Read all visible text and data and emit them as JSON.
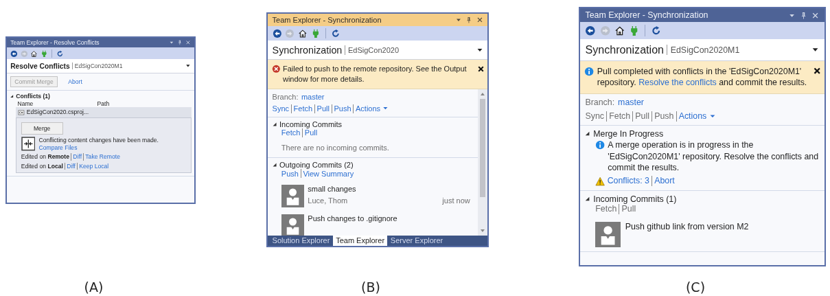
{
  "figure": [
    {
      "caption": "(A)",
      "window": {
        "title": "Team Explorer - Resolve Conflicts",
        "active": false
      },
      "page": {
        "title": "Resolve Conflicts",
        "repository": "EdSigCon2020M1"
      },
      "scrollable": false,
      "actions": [
        {
          "label": "Commit Merge",
          "kind": "button",
          "disabled": true
        },
        {
          "label": "Abort",
          "kind": "link",
          "disabled": false
        }
      ],
      "sections": [
        {
          "kind": "conflicts",
          "title": "Conflicts (1)",
          "expanded": true,
          "columns": [
            "Name",
            "Path"
          ],
          "files": [
            {
              "name": "EdSigCon2020.csproj...",
              "selected": true
            }
          ],
          "detail": {
            "button": "Merge",
            "message": "Conflicting content changes have been made.",
            "link": "Compare Files",
            "edits": [
              {
                "text": "Edited on **Remote**",
                "links": [
                  "Diff",
                  "Take Remote"
                ]
              },
              {
                "text": "Edited on **Local**",
                "links": [
                  "Diff",
                  "Keep Local"
                ]
              }
            ]
          }
        }
      ]
    },
    {
      "caption": "(B)",
      "window": {
        "title": "Team Explorer - Synchronization",
        "active": true
      },
      "page": {
        "title": "Synchronization",
        "repository": "EdSigCon2020"
      },
      "scrollable": true,
      "notice": {
        "kind": "error",
        "parts": [
          {
            "text": "Failed to push to the remote repository. See the Output window for more details.",
            "link": false
          }
        ]
      },
      "branch": {
        "label": "Branch:",
        "value": "master"
      },
      "links": [
        {
          "label": "Sync",
          "disabled": false
        },
        {
          "label": "Fetch",
          "disabled": false
        },
        {
          "label": "Pull",
          "disabled": false
        },
        {
          "label": "Push",
          "disabled": false
        },
        {
          "label": "Actions",
          "disabled": false
        }
      ],
      "sections": [
        {
          "kind": "commits",
          "title": "Incoming Commits",
          "expanded": true,
          "links": [
            {
              "label": "Fetch",
              "disabled": false
            },
            {
              "label": "Pull",
              "disabled": false
            }
          ],
          "message": "There are no incoming commits."
        },
        {
          "kind": "commits",
          "title": "Outgoing Commits (2)",
          "expanded": true,
          "links": [
            {
              "label": "Push",
              "disabled": false
            },
            {
              "label": "View Summary",
              "disabled": false
            }
          ],
          "commits": [
            {
              "message": "small changes",
              "author": "Luce, Thom",
              "time": "just now"
            },
            {
              "message": "Push changes to .gitignore"
            }
          ]
        }
      ],
      "tabs": [
        {
          "label": "Solution Explorer",
          "selected": false
        },
        {
          "label": "Team Explorer",
          "selected": true
        },
        {
          "label": "Server Explorer",
          "selected": false
        }
      ]
    },
    {
      "caption": "(C)",
      "window": {
        "title": "Team Explorer - Synchronization",
        "active": false
      },
      "page": {
        "title": "Synchronization",
        "repository": "EdSigCon2020M1"
      },
      "scrollable": false,
      "notice": {
        "kind": "info",
        "parts": [
          {
            "text": "Pull completed with conflicts in the 'EdSigCon2020M1' repository. ",
            "link": false
          },
          {
            "text": "Resolve the conflicts",
            "link": true
          },
          {
            "text": " and commit the results.",
            "link": false
          }
        ]
      },
      "branch": {
        "label": "Branch:",
        "value": "master"
      },
      "links": [
        {
          "label": "Sync",
          "disabled": true
        },
        {
          "label": "Fetch",
          "disabled": true
        },
        {
          "label": "Pull",
          "disabled": true
        },
        {
          "label": "Push",
          "disabled": true
        },
        {
          "label": "Actions",
          "disabled": false
        }
      ],
      "sections": [
        {
          "kind": "merge",
          "title": "Merge In Progress",
          "expanded": true,
          "info": "A merge operation is in progress in the 'EdSigCon2020M1' repository. Resolve the conflicts and commit the results.",
          "links": [
            {
              "label": "Conflicts: 3",
              "disabled": false
            },
            {
              "label": "Abort",
              "disabled": false
            }
          ]
        },
        {
          "kind": "commits",
          "title": "Incoming Commits (1)",
          "expanded": true,
          "links": [
            {
              "label": "Fetch",
              "disabled": true
            },
            {
              "label": "Pull",
              "disabled": true
            }
          ],
          "commits": [
            {
              "message": "Push github link from version M2"
            }
          ]
        }
      ]
    }
  ]
}
